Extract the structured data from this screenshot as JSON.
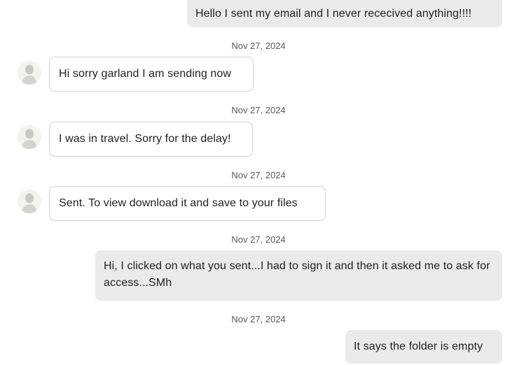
{
  "messages": [
    {
      "direction": "outgoing",
      "text": "Hello I sent my email and I never rececived anything!!!!"
    },
    {
      "direction": "incoming",
      "date": "Nov 27, 2024",
      "text": "Hi sorry garland I am sending now",
      "avatar_icon": "user-avatar-icon"
    },
    {
      "direction": "incoming",
      "date": "Nov 27, 2024",
      "text": "I was in travel. Sorry for the delay!",
      "avatar_icon": "user-avatar-icon"
    },
    {
      "direction": "incoming",
      "date": "Nov 27, 2024",
      "text": "Sent. To view download it and save to your files",
      "avatar_icon": "user-avatar-icon"
    },
    {
      "direction": "outgoing",
      "date": "Nov 27, 2024",
      "text": "Hi, I clicked on what you sent...I had to sign it and then it asked me to ask for access...SMh"
    },
    {
      "direction": "outgoing",
      "date": "Nov 27, 2024",
      "text": "It says the folder is empty"
    }
  ],
  "colors": {
    "outgoing_bubble": "#eaeaea",
    "incoming_bubble": "#ffffff",
    "incoming_border": "#d2d2d2",
    "timestamp": "#595959"
  }
}
